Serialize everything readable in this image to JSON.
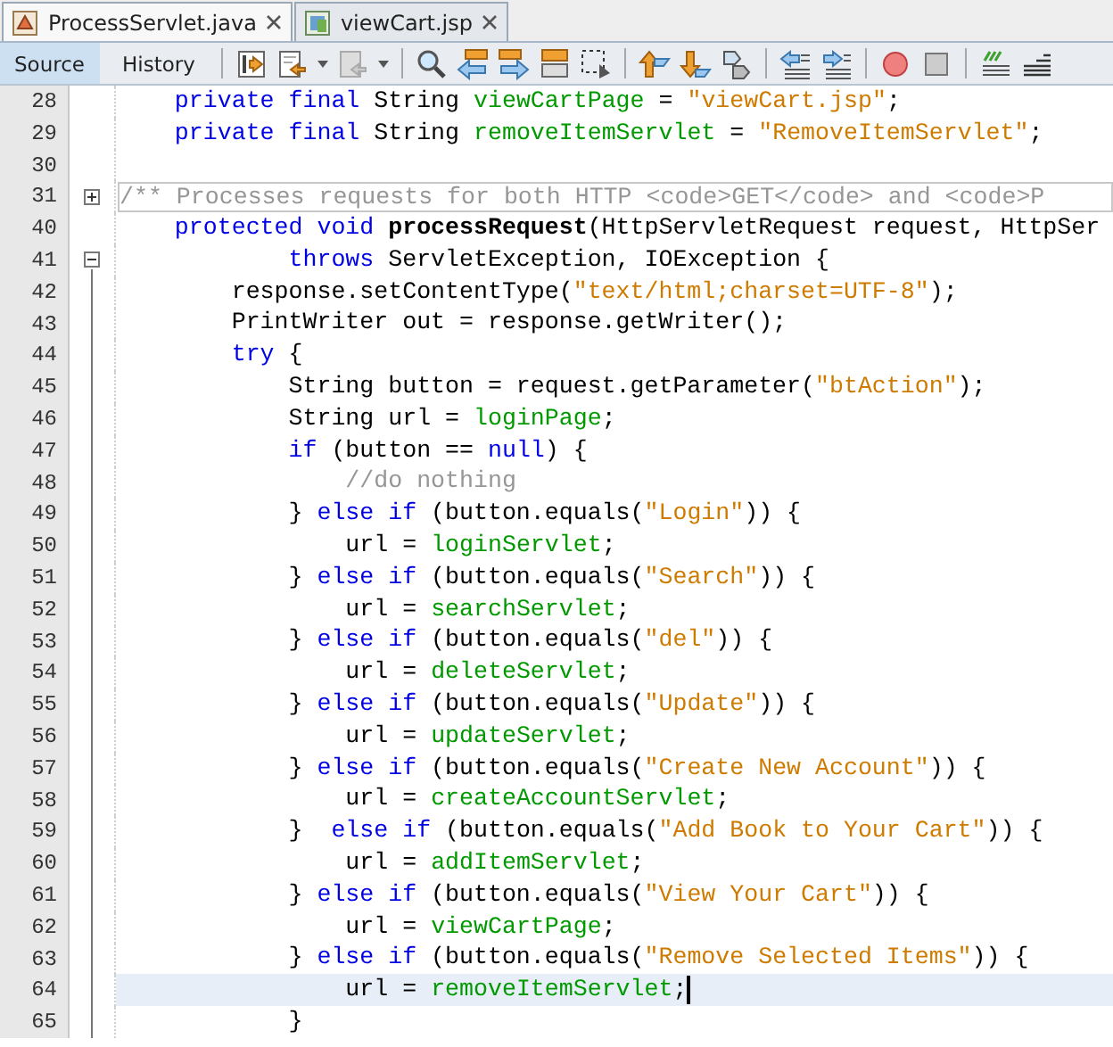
{
  "tabs": [
    {
      "label": "ProcessServlet.java",
      "selected": true,
      "kind": "java"
    },
    {
      "label": "viewCart.jsp",
      "selected": false,
      "kind": "jsp"
    }
  ],
  "view_buttons": [
    {
      "label": "Source",
      "selected": true
    },
    {
      "label": "History",
      "selected": false
    }
  ],
  "lines": [
    {
      "number": "28",
      "kind": "plain",
      "current": false,
      "tokens": [
        {
          "kind": "keyword",
          "text": "    private final"
        },
        {
          "kind": "plain",
          "text": " String "
        },
        {
          "kind": "field",
          "text": "viewCartPage"
        },
        {
          "kind": "plain",
          "text": " = "
        },
        {
          "kind": "string",
          "text": "\"viewCart.jsp\""
        },
        {
          "kind": "plain",
          "text": ";"
        }
      ]
    },
    {
      "number": "29",
      "kind": "plain",
      "current": false,
      "tokens": [
        {
          "kind": "keyword",
          "text": "    private final"
        },
        {
          "kind": "plain",
          "text": " String "
        },
        {
          "kind": "field",
          "text": "removeItemServlet"
        },
        {
          "kind": "plain",
          "text": " = "
        },
        {
          "kind": "string",
          "text": "\"RemoveItemServlet\""
        },
        {
          "kind": "plain",
          "text": ";"
        }
      ]
    },
    {
      "number": "30",
      "kind": "plain",
      "current": false
    },
    {
      "number": "31",
      "kind": "collapsed",
      "current": false,
      "tokens": [
        {
          "kind": "folded",
          "text": "    /** Processes requests for both HTTP <code>GET</code> and <code>P"
        }
      ]
    },
    {
      "number": "40",
      "kind": "plain",
      "current": false,
      "tokens": [
        {
          "kind": "keyword",
          "text": "    protected void "
        },
        {
          "kind": "method",
          "text": "processRequest"
        },
        {
          "kind": "plain",
          "text": "(HttpServletRequest request, HttpSer"
        }
      ]
    },
    {
      "number": "41",
      "kind": "expanded",
      "current": false,
      "tokens": [
        {
          "kind": "keyword",
          "text": "            throws"
        },
        {
          "kind": "plain",
          "text": " ServletException, IOException {"
        }
      ]
    },
    {
      "number": "42",
      "kind": "inside",
      "current": false,
      "tokens": [
        {
          "kind": "plain",
          "text": "        response.setContentType("
        },
        {
          "kind": "string",
          "text": "\"text/html;charset=UTF-8\""
        },
        {
          "kind": "plain",
          "text": ");"
        }
      ]
    },
    {
      "number": "43",
      "kind": "inside",
      "current": false,
      "tokens": [
        {
          "kind": "plain",
          "text": "        PrintWriter out = response.getWriter();"
        }
      ]
    },
    {
      "number": "44",
      "kind": "inside",
      "current": false,
      "tokens": [
        {
          "kind": "keyword",
          "text": "        try"
        },
        {
          "kind": "plain",
          "text": " {"
        }
      ]
    },
    {
      "number": "45",
      "kind": "inside",
      "current": false,
      "tokens": [
        {
          "kind": "plain",
          "text": "            String button = request.getParameter("
        },
        {
          "kind": "string",
          "text": "\"btAction\""
        },
        {
          "kind": "plain",
          "text": ");"
        }
      ]
    },
    {
      "number": "46",
      "kind": "inside",
      "current": false,
      "tokens": [
        {
          "kind": "plain",
          "text": "            String url = "
        },
        {
          "kind": "field",
          "text": "loginPage"
        },
        {
          "kind": "plain",
          "text": ";"
        }
      ]
    },
    {
      "number": "47",
      "kind": "inside",
      "current": false,
      "tokens": [
        {
          "kind": "keyword",
          "text": "            if"
        },
        {
          "kind": "plain",
          "text": " (button == "
        },
        {
          "kind": "keyword",
          "text": "null"
        },
        {
          "kind": "plain",
          "text": ") {"
        }
      ]
    },
    {
      "number": "48",
      "kind": "inside",
      "current": false,
      "tokens": [
        {
          "kind": "comment",
          "text": "                //do nothing"
        }
      ]
    },
    {
      "number": "49",
      "kind": "inside",
      "current": false,
      "tokens": [
        {
          "kind": "plain",
          "text": "            } "
        },
        {
          "kind": "keyword",
          "text": "else if"
        },
        {
          "kind": "plain",
          "text": " (button.equals("
        },
        {
          "kind": "string",
          "text": "\"Login\""
        },
        {
          "kind": "plain",
          "text": ")) {"
        }
      ]
    },
    {
      "number": "50",
      "kind": "inside",
      "current": false,
      "tokens": [
        {
          "kind": "plain",
          "text": "                url = "
        },
        {
          "kind": "field",
          "text": "loginServlet"
        },
        {
          "kind": "plain",
          "text": ";"
        }
      ]
    },
    {
      "number": "51",
      "kind": "inside",
      "current": false,
      "tokens": [
        {
          "kind": "plain",
          "text": "            } "
        },
        {
          "kind": "keyword",
          "text": "else if"
        },
        {
          "kind": "plain",
          "text": " (button.equals("
        },
        {
          "kind": "string",
          "text": "\"Search\""
        },
        {
          "kind": "plain",
          "text": ")) {"
        }
      ]
    },
    {
      "number": "52",
      "kind": "inside",
      "current": false,
      "tokens": [
        {
          "kind": "plain",
          "text": "                url = "
        },
        {
          "kind": "field",
          "text": "searchServlet"
        },
        {
          "kind": "plain",
          "text": ";"
        }
      ]
    },
    {
      "number": "53",
      "kind": "inside",
      "current": false,
      "tokens": [
        {
          "kind": "plain",
          "text": "            } "
        },
        {
          "kind": "keyword",
          "text": "else if"
        },
        {
          "kind": "plain",
          "text": " (button.equals("
        },
        {
          "kind": "string",
          "text": "\"del\""
        },
        {
          "kind": "plain",
          "text": ")) {"
        }
      ]
    },
    {
      "number": "54",
      "kind": "inside",
      "current": false,
      "tokens": [
        {
          "kind": "plain",
          "text": "                url = "
        },
        {
          "kind": "field",
          "text": "deleteServlet"
        },
        {
          "kind": "plain",
          "text": ";"
        }
      ]
    },
    {
      "number": "55",
      "kind": "inside",
      "current": false,
      "tokens": [
        {
          "kind": "plain",
          "text": "            } "
        },
        {
          "kind": "keyword",
          "text": "else if"
        },
        {
          "kind": "plain",
          "text": " (button.equals("
        },
        {
          "kind": "string",
          "text": "\"Update\""
        },
        {
          "kind": "plain",
          "text": ")) {"
        }
      ]
    },
    {
      "number": "56",
      "kind": "inside",
      "current": false,
      "tokens": [
        {
          "kind": "plain",
          "text": "                url = "
        },
        {
          "kind": "field",
          "text": "updateServlet"
        },
        {
          "kind": "plain",
          "text": ";"
        }
      ]
    },
    {
      "number": "57",
      "kind": "inside",
      "current": false,
      "tokens": [
        {
          "kind": "plain",
          "text": "            } "
        },
        {
          "kind": "keyword",
          "text": "else if"
        },
        {
          "kind": "plain",
          "text": " (button.equals("
        },
        {
          "kind": "string",
          "text": "\"Create New Account\""
        },
        {
          "kind": "plain",
          "text": ")) {"
        }
      ]
    },
    {
      "number": "58",
      "kind": "inside",
      "current": false,
      "tokens": [
        {
          "kind": "plain",
          "text": "                url = "
        },
        {
          "kind": "field",
          "text": "createAccountServlet"
        },
        {
          "kind": "plain",
          "text": ";"
        }
      ]
    },
    {
      "number": "59",
      "kind": "inside",
      "current": false,
      "tokens": [
        {
          "kind": "plain",
          "text": "            }  "
        },
        {
          "kind": "keyword",
          "text": "else if"
        },
        {
          "kind": "plain",
          "text": " (button.equals("
        },
        {
          "kind": "string",
          "text": "\"Add Book to Your Cart\""
        },
        {
          "kind": "plain",
          "text": ")) {"
        }
      ]
    },
    {
      "number": "60",
      "kind": "inside",
      "current": false,
      "tokens": [
        {
          "kind": "plain",
          "text": "                url = "
        },
        {
          "kind": "field",
          "text": "addItemServlet"
        },
        {
          "kind": "plain",
          "text": ";"
        }
      ]
    },
    {
      "number": "61",
      "kind": "inside",
      "current": false,
      "tokens": [
        {
          "kind": "plain",
          "text": "            } "
        },
        {
          "kind": "keyword",
          "text": "else if"
        },
        {
          "kind": "plain",
          "text": " (button.equals("
        },
        {
          "kind": "string",
          "text": "\"View Your Cart\""
        },
        {
          "kind": "plain",
          "text": ")) {"
        }
      ]
    },
    {
      "number": "62",
      "kind": "inside",
      "current": false,
      "tokens": [
        {
          "kind": "plain",
          "text": "                url = "
        },
        {
          "kind": "field",
          "text": "viewCartPage"
        },
        {
          "kind": "plain",
          "text": ";"
        }
      ]
    },
    {
      "number": "63",
      "kind": "inside",
      "current": false,
      "tokens": [
        {
          "kind": "plain",
          "text": "            } "
        },
        {
          "kind": "keyword",
          "text": "else if"
        },
        {
          "kind": "plain",
          "text": " (button.equals("
        },
        {
          "kind": "string",
          "text": "\"Remove Selected Items\""
        },
        {
          "kind": "plain",
          "text": ")) {"
        }
      ]
    },
    {
      "number": "64",
      "kind": "inside",
      "current": true,
      "tokens": [
        {
          "kind": "plain",
          "text": "                url = "
        },
        {
          "kind": "field",
          "text": "removeItemServlet"
        },
        {
          "kind": "plain",
          "text": ";"
        }
      ]
    },
    {
      "number": "65",
      "kind": "inside",
      "current": false,
      "tokens": [
        {
          "kind": "plain",
          "text": "            }"
        }
      ]
    }
  ]
}
